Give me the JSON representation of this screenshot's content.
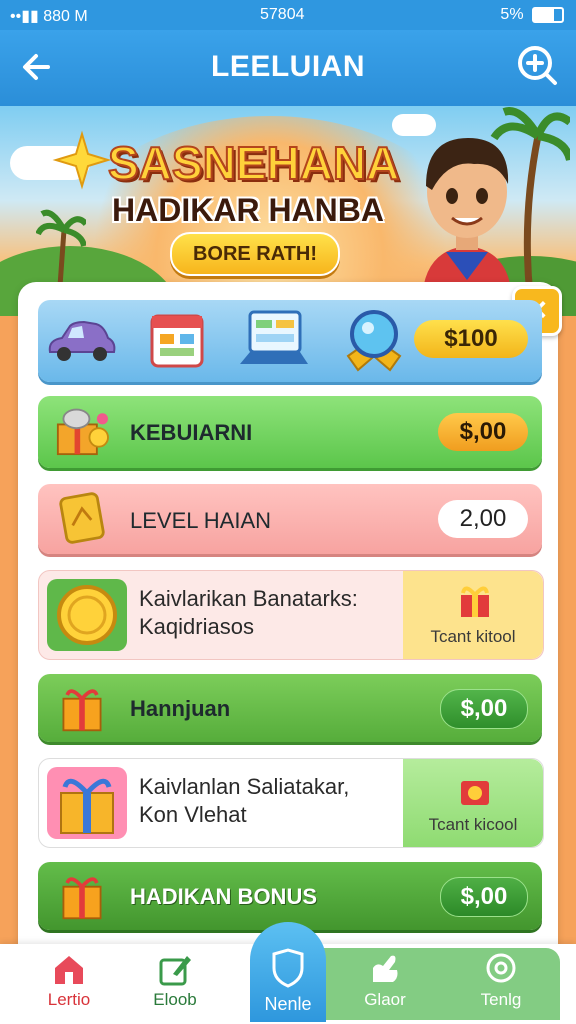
{
  "status_bar": {
    "left": "••▮▮ 880 M",
    "center": "57804",
    "right": "5%"
  },
  "app_bar": {
    "title": "LEELUIAN"
  },
  "banner": {
    "headline": "SASNEHANA",
    "subhead": "HADIKAR HANBA",
    "button_label": "BORE RATH!"
  },
  "shop_row": {
    "amount": "$100"
  },
  "rows": [
    {
      "label": "KEBUIARNI",
      "amount": "$,00"
    },
    {
      "label": "LEVEL HAIAN",
      "amount": "2,00"
    },
    {
      "text_line1": "Kaivlarikan Banatarks:",
      "text_line2": "Kaqidriasos",
      "task_label": "Tcant kitool"
    },
    {
      "label": "Hannjuan",
      "amount": "$,00"
    },
    {
      "text_line1": "Kaivlanlan Saliatakar,",
      "text_line2": "Kon Vlehat",
      "task_label": "Tcant kicool"
    },
    {
      "label": "HADIKAN BONUS",
      "amount": "$,00"
    }
  ],
  "bottom_nav": [
    {
      "label": "Lertio",
      "icon": "house-icon"
    },
    {
      "label": "Eloob",
      "icon": "edit-icon"
    },
    {
      "label": "Nenle",
      "icon": "shield-icon"
    },
    {
      "label": "Glaor",
      "icon": "hand-icon"
    },
    {
      "label": "Tenlg",
      "icon": "search-icon"
    }
  ],
  "colors": {
    "app_bar": "#2f97e0",
    "accent_yellow": "#f8b81e",
    "green": "#5cc64b"
  }
}
